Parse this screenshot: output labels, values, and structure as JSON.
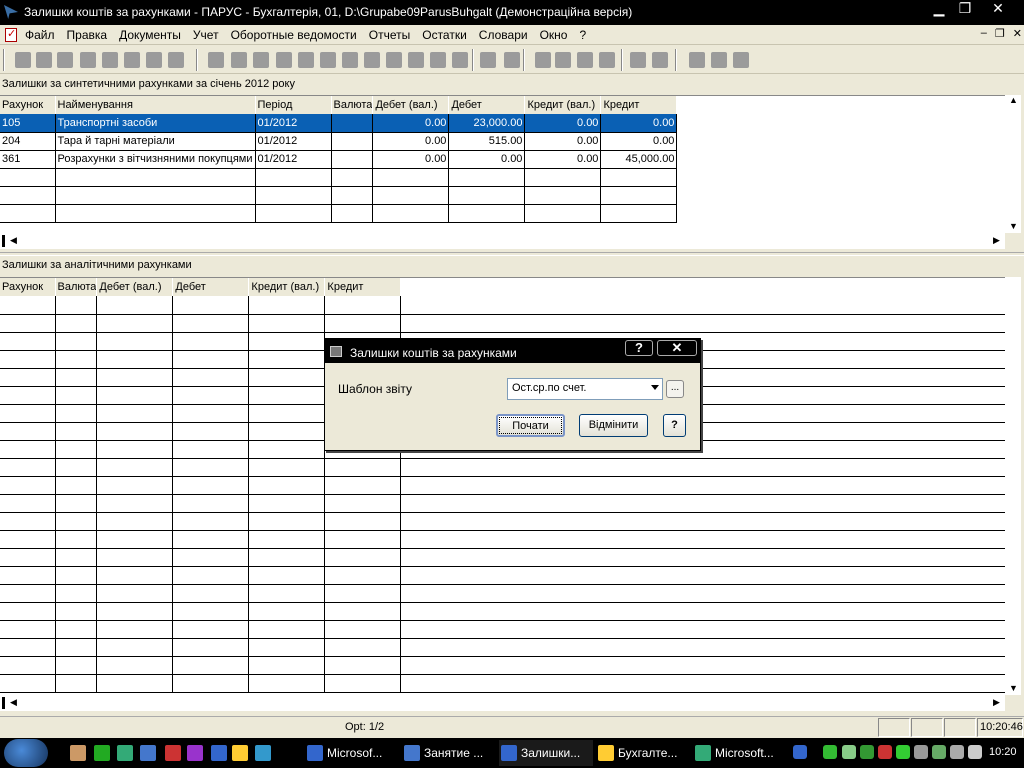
{
  "window": {
    "title": "Залишки коштів за рахунками - ПАРУС - Бухгалтерія, 01, D:\\Grupabe09ParusBuhgalt (Демонстраційна версія)",
    "minimize": "▁",
    "maximize": "❐",
    "close": "✕"
  },
  "menu": {
    "items": [
      "Файл",
      "Правка",
      "Документы",
      "Учет",
      "Оборотные ведомости",
      "Отчеты",
      "Остатки",
      "Словари",
      "Окно",
      "?"
    ],
    "mdi_min": "–",
    "mdi_restore": "❐",
    "mdi_close": "✕"
  },
  "toolbar_icons": [
    "copy-icon",
    "duplicate-icon",
    "edit-icon",
    "delete-icon",
    "filter-icon",
    "stamp-icon",
    "print-icon",
    "package-icon",
    "arrow-icon",
    "document-icon",
    "card-icon",
    "book-icon",
    "transfer-icon",
    "doc-forward-icon",
    "building-icon",
    "table-icon",
    "tools-icon",
    "money-icon",
    "people-icon",
    "settings-icon",
    "coins-icon",
    "currency-icon",
    "briefcase-icon",
    "asset-icon",
    "report-icon",
    "report2-icon",
    "calculator-icon",
    "wrench-icon",
    "folder-icon",
    "check-icon",
    "exit-icon"
  ],
  "top_panel": {
    "caption": "Залишки за синтетичними рахунками за січень 2012 року",
    "columns": [
      "Рахунок",
      "Найменування",
      "Період",
      "Валюта",
      "Дебет (вал.)",
      "Дебет",
      "Кредит (вал.)",
      "Кредит"
    ],
    "rows": [
      {
        "account": "105",
        "name": "Транспортні засоби",
        "period": "01/2012",
        "currency": "",
        "debit_cur": "0.00",
        "debit": "23,000.00",
        "credit_cur": "0.00",
        "credit": "0.00"
      },
      {
        "account": "204",
        "name": "Тара й тарні матеріали",
        "period": "01/2012",
        "currency": "",
        "debit_cur": "0.00",
        "debit": "515.00",
        "credit_cur": "0.00",
        "credit": "0.00"
      },
      {
        "account": "361",
        "name": "Розрахунки з вітчизняними покупцями",
        "period": "01/2012",
        "currency": "",
        "debit_cur": "0.00",
        "debit": "0.00",
        "credit_cur": "0.00",
        "credit": "45,000.00"
      }
    ],
    "selected_row": 0
  },
  "bottom_panel": {
    "caption": "Залишки за аналітичними рахунками",
    "columns": [
      "Рахунок",
      "Валюта",
      "Дебет (вал.)",
      "Дебет",
      "Кредит (вал.)",
      "Кредит"
    ]
  },
  "status": {
    "record": "Opt: 1/2",
    "time": "10:20:46"
  },
  "dialog": {
    "title": "Залишки коштів за рахунками",
    "help_btn": "?",
    "close_btn": "✕",
    "template_label": "Шаблон звіту",
    "template_value": "Ост.ср.по счет.",
    "browse": "...",
    "start": "Почати",
    "cancel": "Відмінити",
    "help": "?"
  },
  "taskbar": {
    "tasks": [
      "Microsof...",
      "Занятие ...",
      "Залишки...",
      "Бухгалте...",
      "Microsoft..."
    ],
    "active": 2,
    "clock": "10:20"
  }
}
